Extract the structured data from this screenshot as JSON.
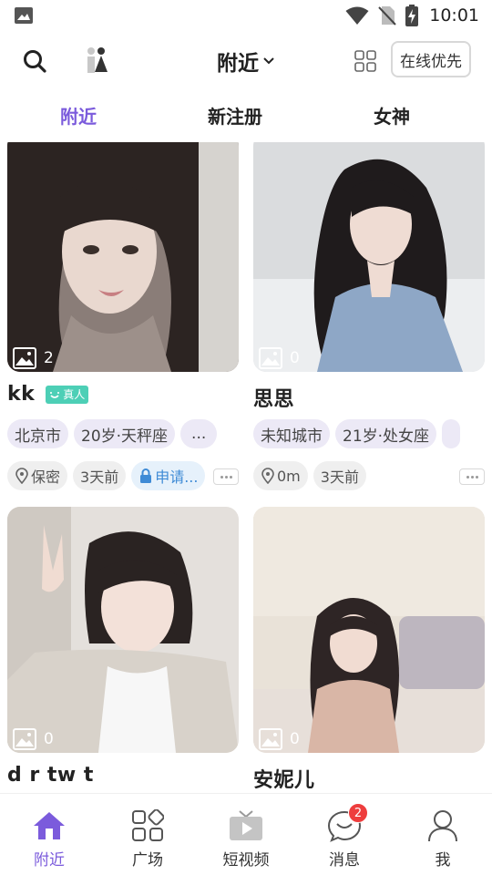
{
  "status_bar": {
    "time": "10:01"
  },
  "header": {
    "title": "附近",
    "online_first_label": "在线优先"
  },
  "tabs": [
    {
      "label": "附近",
      "active": true
    },
    {
      "label": "新注册",
      "active": false
    },
    {
      "label": "女神",
      "active": false
    }
  ],
  "colors": {
    "accent": "#7b5bdc",
    "real_badge": "#4dcfb6",
    "tag_bg": "#ece9f6",
    "apply_text": "#3f8bd6",
    "badge_red": "#ee3d3d"
  },
  "cards": [
    {
      "name": "kk",
      "real_badge": "真人",
      "photo_count": "2",
      "tags": [
        "北京市",
        "20岁·天秤座",
        "..."
      ],
      "distance": "保密",
      "last_active": "3天前",
      "apply_label": "申请..."
    },
    {
      "name": "思思",
      "photo_count": "0",
      "tags": [
        "未知城市",
        "21岁·处女座",
        ""
      ],
      "distance": "0m",
      "last_active": "3天前"
    },
    {
      "name": "d r tw t",
      "photo_count": "0"
    },
    {
      "name": "安妮儿",
      "photo_count": "0"
    }
  ],
  "bottom_nav": [
    {
      "label": "附近",
      "icon": "home-icon",
      "active": true
    },
    {
      "label": "广场",
      "icon": "apps-icon",
      "active": false
    },
    {
      "label": "短视频",
      "icon": "tv-icon",
      "active": false
    },
    {
      "label": "消息",
      "icon": "chat-icon",
      "active": false,
      "badge": "2"
    },
    {
      "label": "我",
      "icon": "user-icon",
      "active": false
    }
  ]
}
